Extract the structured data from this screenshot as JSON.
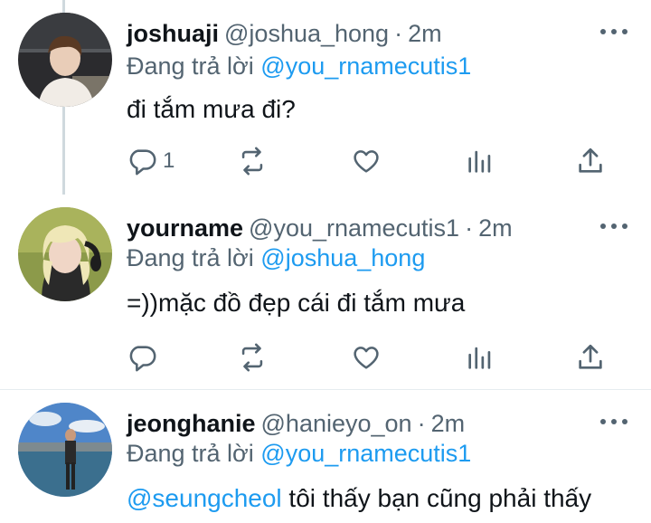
{
  "tweets": [
    {
      "display_name": "joshuaji",
      "handle": "@joshua_hong",
      "time": "2m",
      "replying_prefix": "Đang trả lời",
      "replying_to": "@you_rnamecutis1",
      "text": "đi tắm mưa đi?",
      "reply_count": "1",
      "avatar": "photo of a man in white shirt"
    },
    {
      "display_name": "yourname",
      "handle": "@you_rnamecutis1",
      "time": "2m",
      "replying_prefix": "Đang trả lời",
      "replying_to": "@joshua_hong",
      "text": "=))mặc đồ đẹp cái đi tắm mưa",
      "reply_count": "",
      "avatar": "photo of blonde person with headphones"
    },
    {
      "display_name": "jeonghanie",
      "handle": "@hanieyo_on",
      "time": "2m",
      "replying_prefix": "Đang trả lời",
      "replying_to": "@you_rnamecutis1",
      "mention": "@seungcheol",
      "text": " tôi thấy bạn cũng phải thấy",
      "avatar": "photo of person standing by water under blue sky"
    }
  ],
  "icons": [
    "reply-icon",
    "retweet-icon",
    "like-icon",
    "analytics-icon",
    "share-icon",
    "more-icon"
  ],
  "colors": {
    "link": "#1d9bf0",
    "secondary_text": "#536471",
    "thread_line": "#cfd9de"
  }
}
